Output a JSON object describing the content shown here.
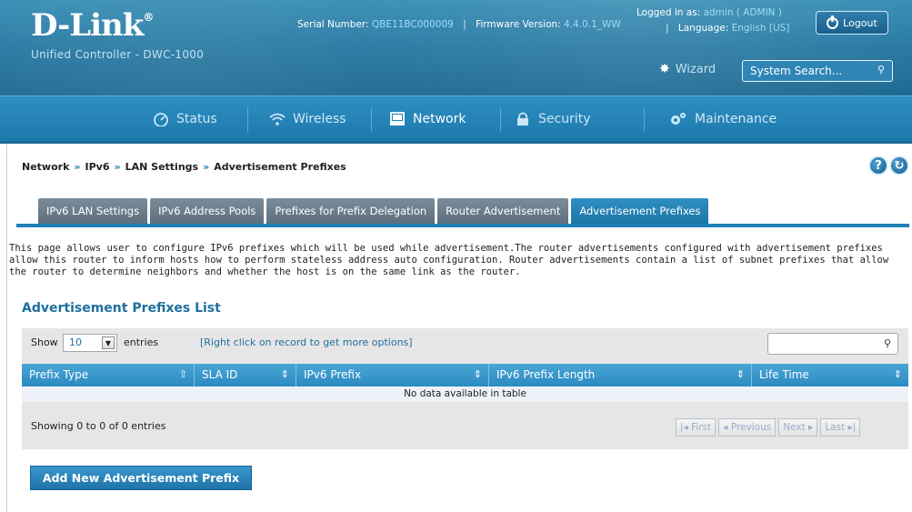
{
  "brand": {
    "logo": "D-Link",
    "logo_mark": "®",
    "subtitle": "Unified Controller - DWC-1000"
  },
  "header": {
    "logged_in_label": "Logged in as:",
    "logged_in_value": "admin ( ADMIN )",
    "serial_label": "Serial Number:",
    "serial_value": "QBE11BC000009",
    "firmware_label": "Firmware Version:",
    "firmware_value": "4.4.0.1_WW",
    "language_label": "Language:",
    "language_value": "English [US]",
    "logout_label": "Logout",
    "wizard_label": "Wizard",
    "search_placeholder": "System Search..."
  },
  "nav": {
    "items": [
      {
        "label": "Status",
        "icon": "gauge-icon",
        "active": false
      },
      {
        "label": "Wireless",
        "icon": "wifi-icon",
        "active": false
      },
      {
        "label": "Network",
        "icon": "monitor-icon",
        "active": true
      },
      {
        "label": "Security",
        "icon": "lock-icon",
        "active": false
      },
      {
        "label": "Maintenance",
        "icon": "gears-icon",
        "active": false
      }
    ]
  },
  "breadcrumb": [
    "Network",
    "IPv6",
    "LAN Settings",
    "Advertisement Prefixes"
  ],
  "breadcrumb_sep": "»",
  "tabs": [
    {
      "label": "IPv6 LAN Settings",
      "active": false
    },
    {
      "label": "IPv6 Address Pools",
      "active": false
    },
    {
      "label": "Prefixes for Prefix Delegation",
      "active": false
    },
    {
      "label": "Router Advertisement",
      "active": false
    },
    {
      "label": "Advertisement Prefixes",
      "active": true
    }
  ],
  "description": "This page allows user to configure IPv6 prefixes which will be used while advertisement.The router advertisements configured with advertisement prefixes allow this router to inform hosts how to perform stateless address auto configuration. Router advertisements contain a list of subnet prefixes that allow the router to determine neighbors and whether the host is on the same link as the router.",
  "list": {
    "title": "Advertisement Prefixes List",
    "show_label": "Show",
    "show_value": "10",
    "entries_label": "entries",
    "hint": "[Right click on record to get more options]",
    "columns": [
      {
        "label": "Prefix Type",
        "sort": "asc"
      },
      {
        "label": "SLA ID",
        "sort": "both"
      },
      {
        "label": "IPv6 Prefix",
        "sort": "both"
      },
      {
        "label": "IPv6 Prefix Length",
        "sort": "both"
      },
      {
        "label": "Life Time",
        "sort": "both"
      }
    ],
    "empty_text": "No data available in table",
    "showing_text": "Showing 0 to 0 of 0 entries",
    "pager": {
      "first": "First",
      "previous": "Previous",
      "next": "Next",
      "last": "Last"
    }
  },
  "add_button": "Add New Advertisement Prefix",
  "colors": {
    "header_blue": "#2a7aa3",
    "accent_blue": "#1f7fb5",
    "tab_gray": "#6a7c8a",
    "link_blue": "#1f6f9e"
  }
}
